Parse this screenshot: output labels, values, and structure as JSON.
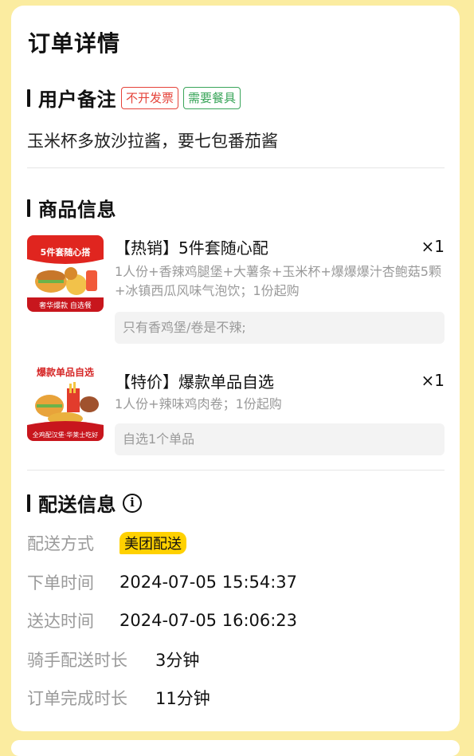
{
  "page": {
    "title": "订单详情"
  },
  "remarks": {
    "title": "用户备注",
    "tags": [
      "不开发票",
      "需要餐具"
    ],
    "note": "玉米杯多放沙拉酱，要七包番茄酱"
  },
  "products": {
    "title": "商品信息",
    "items": [
      {
        "name": "【热销】5件套随心配",
        "qty": "×1",
        "desc": "1人份+香辣鸡腿堡+大薯条+玉米杯+爆爆爆汁杏鲍菇5颗+冰镇西瓜风味气泡饮；1份起购",
        "note": "只有香鸡堡/卷是不辣;",
        "thumb_text": "5件套随心搭",
        "thumb_sub": "奢华爆款 自选餐"
      },
      {
        "name": "【特价】爆款单品自选",
        "qty": "×1",
        "desc": "1人份+辣味鸡肉卷；1份起购",
        "note": "自选1个单品",
        "thumb_text": "爆款单品自选",
        "thumb_sub": "全鸡配汉堡·华莱士吃好"
      }
    ]
  },
  "delivery": {
    "title": "配送信息",
    "info_icon": "i",
    "rows": [
      {
        "label": "配送方式",
        "value": "美团配送"
      },
      {
        "label": "下单时间",
        "value": "2024-07-05 15:54:37"
      },
      {
        "label": "送达时间",
        "value": "2024-07-05 16:06:23"
      },
      {
        "label": "骑手配送时长",
        "value": "3分钟"
      },
      {
        "label": "订单完成时长",
        "value": "11分钟"
      }
    ]
  },
  "colors": {
    "background": "#fbeca0",
    "tag_red": "#e5433a",
    "tag_green": "#3aa55a",
    "badge_yellow": "#ffd100"
  }
}
